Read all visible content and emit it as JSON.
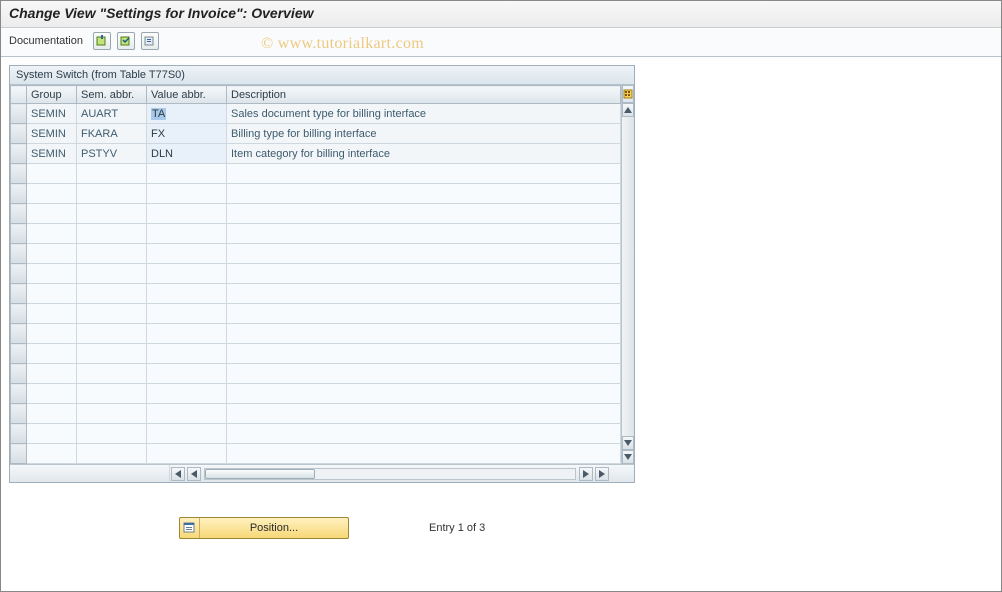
{
  "title": "Change View \"Settings for Invoice\": Overview",
  "toolbar": {
    "documentation_label": "Documentation"
  },
  "panel": {
    "title": "System Switch (from Table T77S0)"
  },
  "columns": {
    "group": "Group",
    "sem": "Sem. abbr.",
    "val": "Value abbr.",
    "desc": "Description"
  },
  "rows": [
    {
      "group": "SEMIN",
      "sem": "AUART",
      "val": "TA",
      "desc": "Sales document type for billing interface"
    },
    {
      "group": "SEMIN",
      "sem": "FKARA",
      "val": "FX",
      "desc": "Billing type for billing interface"
    },
    {
      "group": "SEMIN",
      "sem": "PSTYV",
      "val": "DLN",
      "desc": "Item category for billing interface"
    }
  ],
  "footer": {
    "position_label": "Position...",
    "entry_text": "Entry 1 of 3"
  },
  "watermark": "© www.tutorialkart.com"
}
